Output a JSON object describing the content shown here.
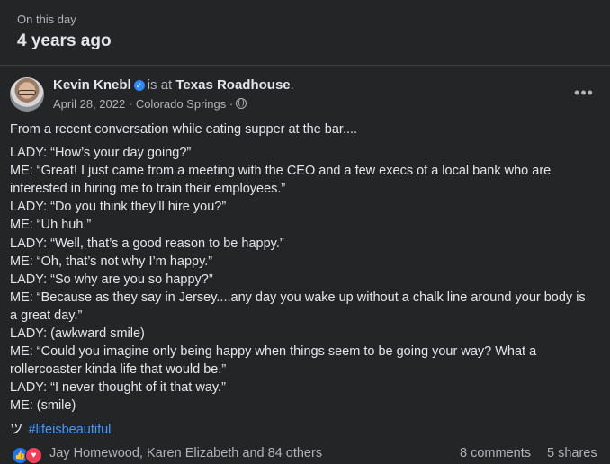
{
  "memory": {
    "label": "On this day",
    "title": "4 years ago"
  },
  "post": {
    "author": "Kevin Knebl",
    "verified_icon": "verified-badge-icon",
    "check_in_prefix": "is at",
    "place": "Texas Roadhouse",
    "date": "April 28, 2022",
    "location": "Colorado Springs",
    "privacy_icon": "globe-icon",
    "more_label": "•••",
    "lines": [
      "From a recent conversation while eating supper at the bar....",
      "",
      "LADY: “How’s your day going?”",
      "ME: “Great! I just came from a meeting with the CEO and a few execs of a local bank who are interested in hiring me to train their employees.”",
      "LADY: “Do you think they’ll hire you?”",
      "ME: “Uh huh.”",
      "LADY: “Well, that’s a good reason to be happy.”",
      "ME: “Oh, that’s not why I’m happy.”",
      "LADY: “So why are you so happy?”",
      "ME: “Because as they say in Jersey....any day you wake up without a chalk line around your body is a great day.”",
      "LADY: (awkward smile)",
      "ME: “Could you imagine only being happy when things seem to be going your way? What a rollercoaster kinda life that would be.”",
      "LADY: “I never thought of it that way.”",
      "ME: (smile)"
    ],
    "tsu": "ツ",
    "hashtag": "#lifeisbeautiful"
  },
  "engagement": {
    "like_icon": "like-reaction-icon",
    "love_icon": "love-reaction-icon",
    "reactors": "Jay Homewood, Karen Elizabeth and 84 others",
    "comments": "8 comments",
    "shares": "5 shares"
  },
  "colors": {
    "background": "#242526",
    "text_primary": "#e4e6eb",
    "text_secondary": "#b0b3b8",
    "link": "#4599ff",
    "like": "#1877f2",
    "love": "#f33e58",
    "verified": "#2d88ff"
  }
}
